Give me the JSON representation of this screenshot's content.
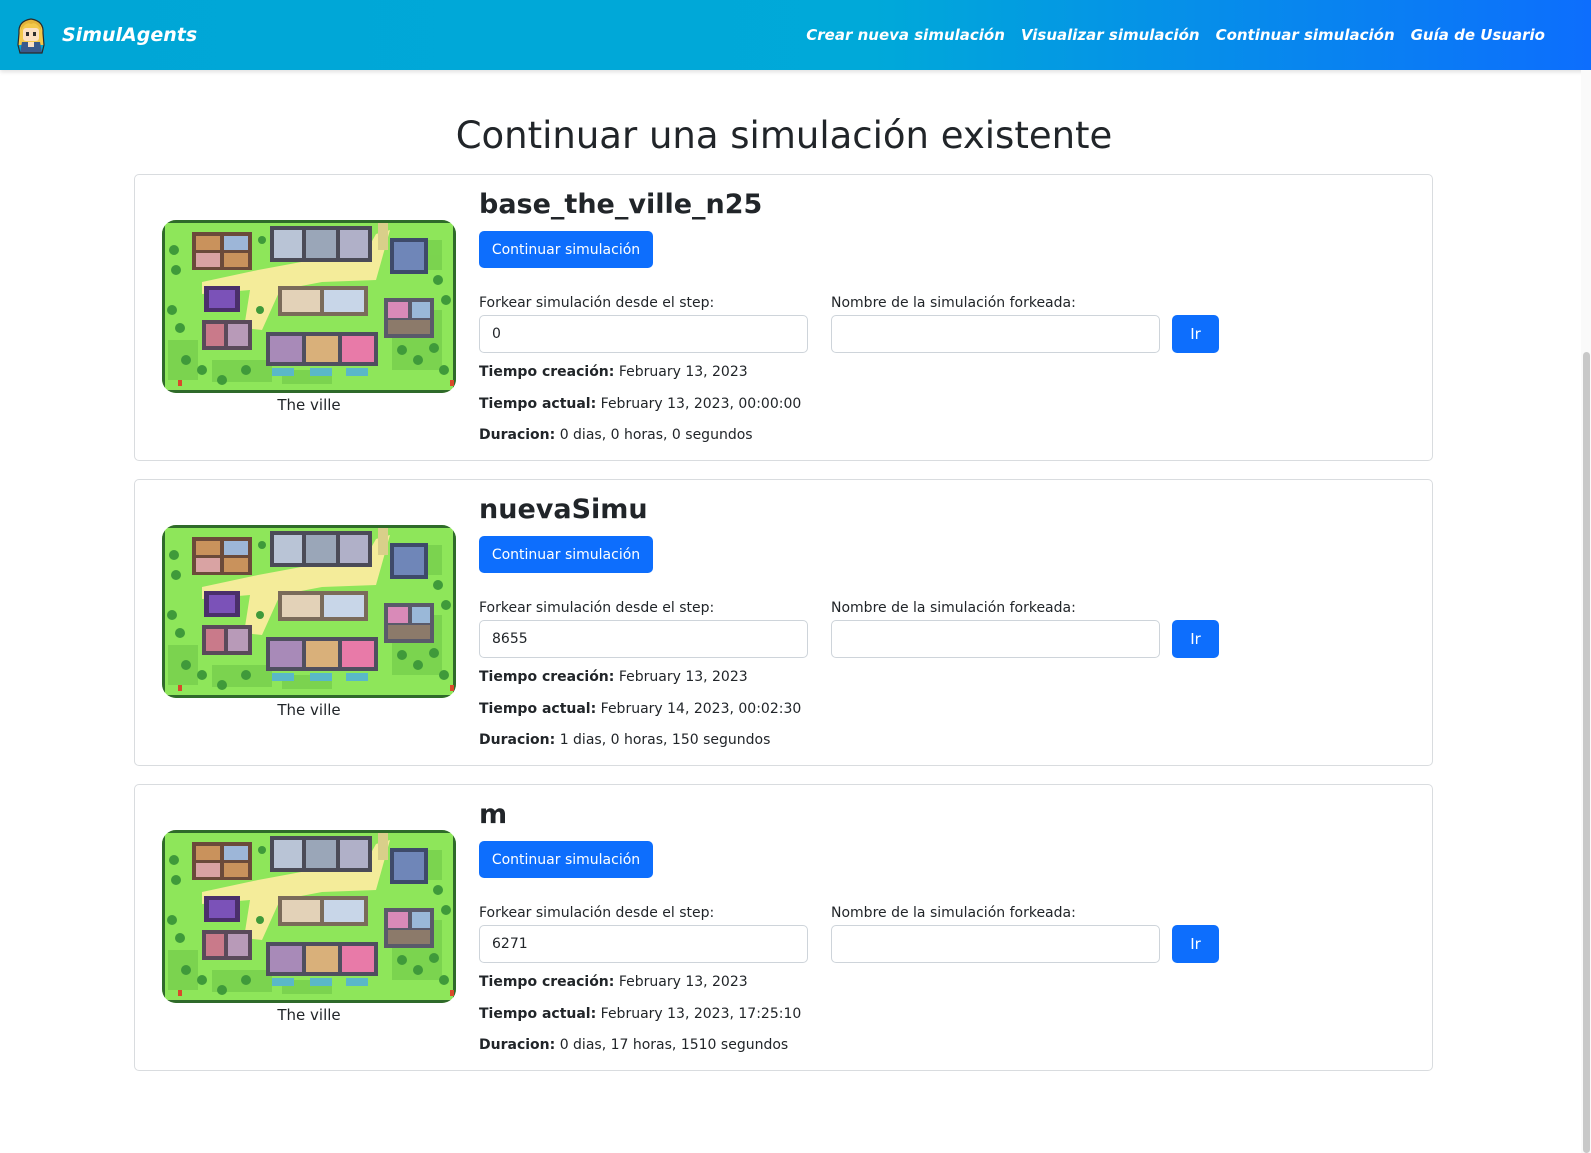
{
  "navbar": {
    "brand": "SimulAgents",
    "links": [
      {
        "label": "Crear nueva simulación"
      },
      {
        "label": "Visualizar simulación"
      },
      {
        "label": "Continuar simulación"
      },
      {
        "label": "Guía de Usuario"
      }
    ]
  },
  "page": {
    "title": "Continuar una simulación existente"
  },
  "common": {
    "continue_label": "Continuar simulación",
    "fork_step_label": "Forkear simulación desde el step:",
    "fork_name_label": "Nombre de la simulación forkeada:",
    "go_label": "Ir",
    "created_label": "Tiempo creación:",
    "current_label": "Tiempo actual:",
    "duration_label": "Duracion:"
  },
  "simulations": [
    {
      "name": "base_the_ville_n25",
      "map_caption": "The ville",
      "fork_step": "0",
      "fork_name": "",
      "created": "February 13, 2023",
      "current": "February 13, 2023, 00:00:00",
      "duration": "0 dias, 0 horas, 0 segundos"
    },
    {
      "name": "nuevaSimu",
      "map_caption": "The ville",
      "fork_step": "8655",
      "fork_name": "",
      "created": "February 13, 2023",
      "current": "February 14, 2023, 00:02:30",
      "duration": "1 dias, 0 horas, 150 segundos"
    },
    {
      "name": "m",
      "map_caption": "The ville",
      "fork_step": "6271",
      "fork_name": "",
      "created": "February 13, 2023",
      "current": "February 13, 2023, 17:25:10",
      "duration": "0 dias, 17 horas, 1510 segundos"
    }
  ],
  "colors": {
    "primary": "#0d6efd",
    "nav_gradient_start": "#00a6d6",
    "nav_gradient_end": "#0d6efd",
    "map_grass": "#8ee65a"
  },
  "icons": {
    "brand": "character-avatar-icon",
    "map": "town-map-thumbnail"
  }
}
